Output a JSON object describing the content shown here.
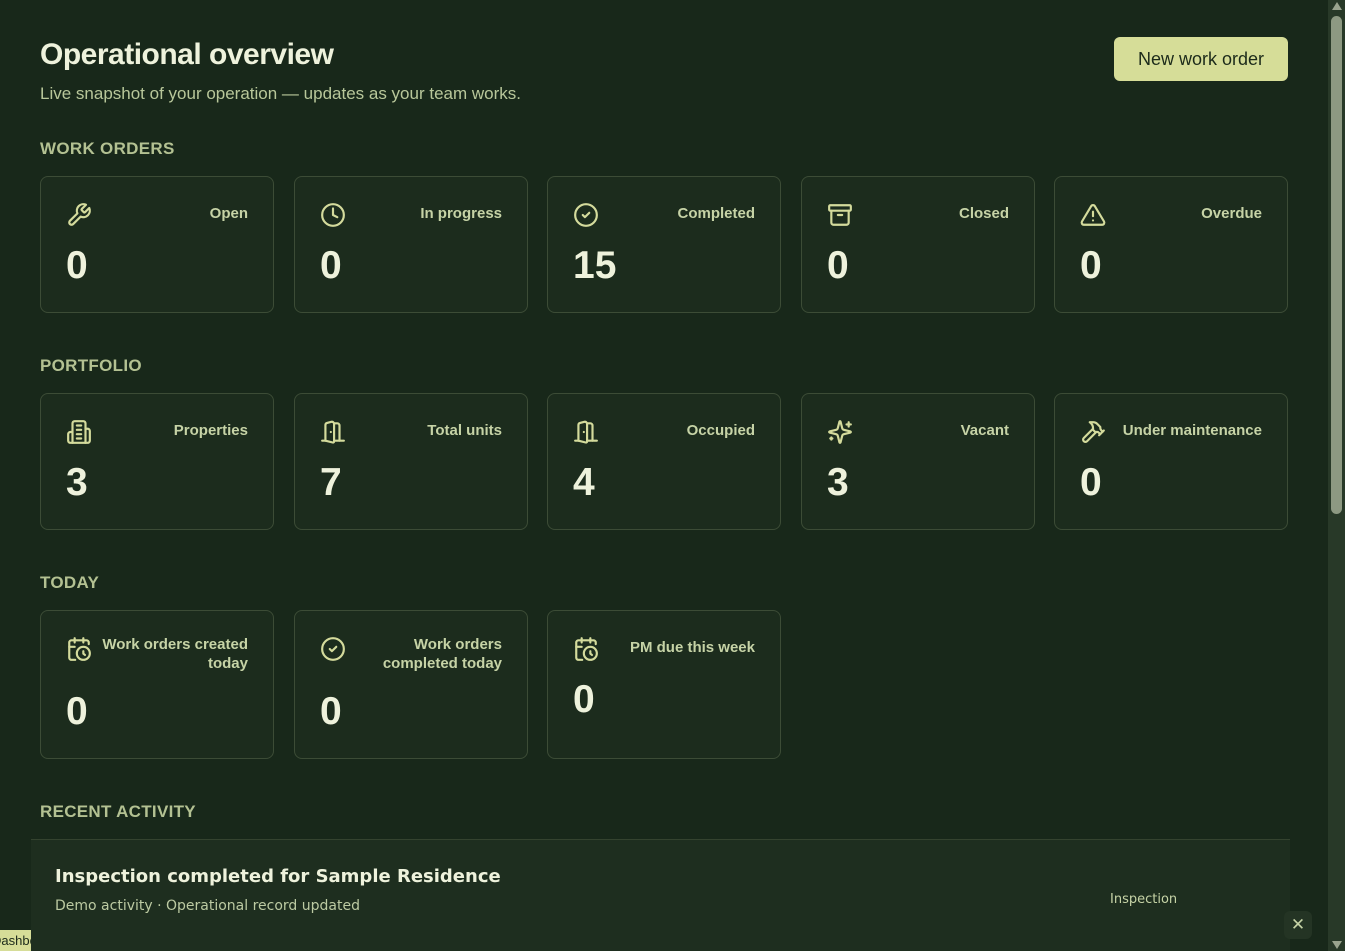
{
  "header": {
    "title": "Operational overview",
    "subtitle": "Live snapshot of your operation — updates as your team works.",
    "new_work_order_label": "New work order"
  },
  "sections": {
    "work_orders": {
      "label": "WORK ORDERS",
      "cards": [
        {
          "label": "Open",
          "value": "0",
          "icon": "wrench-icon"
        },
        {
          "label": "In progress",
          "value": "0",
          "icon": "clock-icon"
        },
        {
          "label": "Completed",
          "value": "15",
          "icon": "check-circle-icon"
        },
        {
          "label": "Closed",
          "value": "0",
          "icon": "archive-icon"
        },
        {
          "label": "Overdue",
          "value": "0",
          "icon": "warning-icon"
        }
      ]
    },
    "portfolio": {
      "label": "PORTFOLIO",
      "cards": [
        {
          "label": "Properties",
          "value": "3",
          "icon": "building-icon"
        },
        {
          "label": "Total units",
          "value": "7",
          "icon": "door-icon"
        },
        {
          "label": "Occupied",
          "value": "4",
          "icon": "door-open-icon"
        },
        {
          "label": "Vacant",
          "value": "3",
          "icon": "sparkles-icon"
        },
        {
          "label": "Under maintenance",
          "value": "0",
          "icon": "hammer-icon"
        }
      ]
    },
    "today": {
      "label": "TODAY",
      "cards": [
        {
          "label": "Work orders created today",
          "value": "0",
          "icon": "calendar-clock-icon"
        },
        {
          "label": "Work orders completed today",
          "value": "0",
          "icon": "check-circle-icon"
        },
        {
          "label": "PM due this week",
          "value": "0",
          "icon": "calendar-clock-icon"
        }
      ]
    },
    "recent_activity": {
      "label": "RECENT ACTIVITY",
      "items": [
        {
          "title": "Inspection completed for Sample Residence",
          "subtitle": "Demo activity · Operational record updated",
          "tag": "Inspection"
        }
      ]
    }
  },
  "status_tab_text": "Dashboard",
  "close_glyph": "✕",
  "colors": {
    "background": "#18281a",
    "card_background": "#1c2c1d",
    "card_border": "#3c4c36",
    "accent": "#d6dd98",
    "text_primary": "#eef2dc",
    "text_muted": "#b3c192"
  }
}
